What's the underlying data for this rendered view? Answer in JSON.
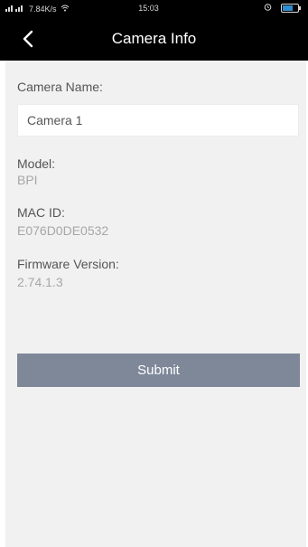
{
  "status_bar": {
    "network_text": "7.84K/s",
    "time": "15:03"
  },
  "header": {
    "title": "Camera Info",
    "back_icon": "chevron-left-icon"
  },
  "form": {
    "camera_name_label": "Camera Name:",
    "camera_name_value": "Camera 1",
    "model_label": "Model:",
    "model_value": "BPI",
    "mac_label": "MAC ID:",
    "mac_value": "E076D0DE0532",
    "firmware_label": "Firmware Version:",
    "firmware_value": "2.74.1.3",
    "submit_label": "Submit"
  },
  "colors": {
    "header_bg": "#000000",
    "panel_bg": "#f1f1f1",
    "button_bg": "#7f8899",
    "label_text": "#555555",
    "value_text": "#a7a7a7"
  }
}
